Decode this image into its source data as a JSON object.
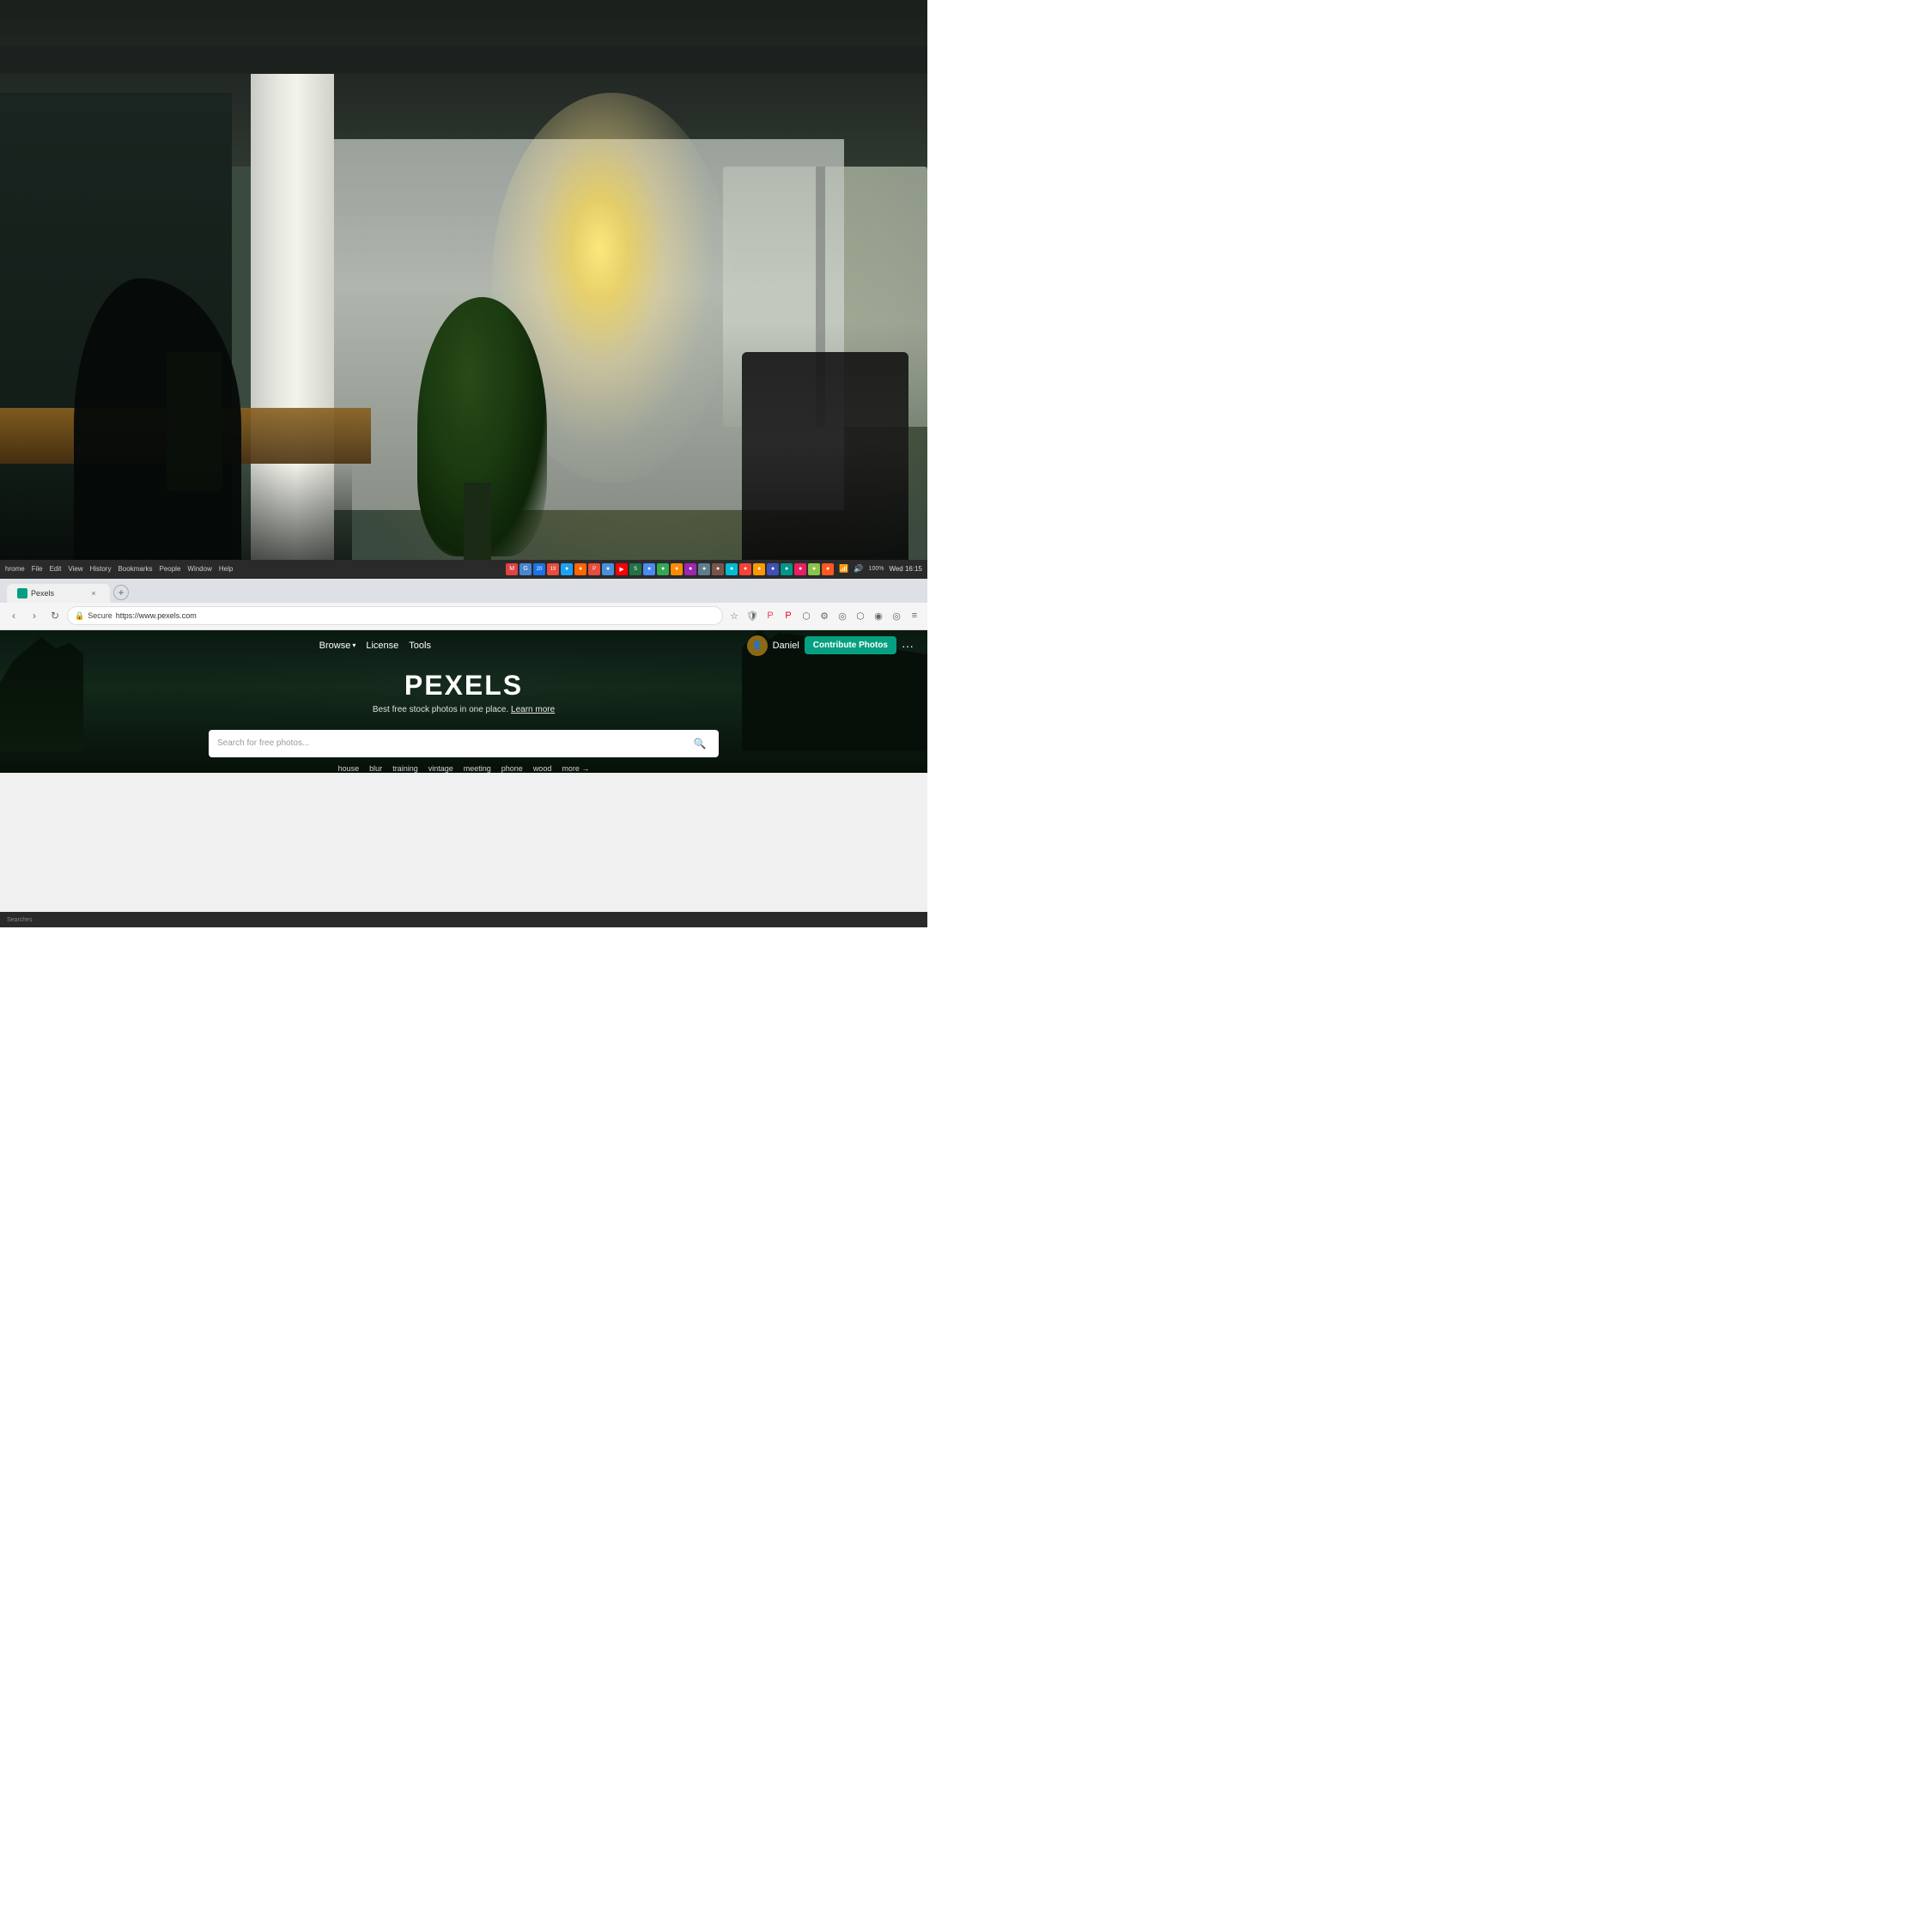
{
  "background": {
    "description": "Office interior with bokeh effect - trees, windows, column, chairs"
  },
  "system_bar": {
    "menu_items": [
      "hrome",
      "File",
      "Edit",
      "View",
      "History",
      "Bookmarks",
      "People",
      "Window",
      "Help"
    ],
    "time": "Wed 16:15",
    "battery": "100%",
    "wifi": "on"
  },
  "browser": {
    "tab_title": "Pexels",
    "url_secure_label": "Secure",
    "url": "https://www.pexels.com",
    "nav_back": "‹",
    "nav_forward": "›",
    "nav_refresh": "↻"
  },
  "pexels": {
    "nav": {
      "browse_label": "Browse",
      "license_label": "License",
      "tools_label": "Tools",
      "user_name": "Daniel",
      "contribute_label": "Contribute Photos",
      "more_label": "···"
    },
    "hero": {
      "logo": "PEXELS",
      "tagline": "Best free stock photos in one place.",
      "learn_more": "Learn more",
      "search_placeholder": "Search for free photos..."
    },
    "suggestions": [
      "house",
      "blur",
      "training",
      "vintage",
      "meeting",
      "phone",
      "wood",
      "more →"
    ]
  },
  "taskbar": {
    "label": "Searches"
  }
}
